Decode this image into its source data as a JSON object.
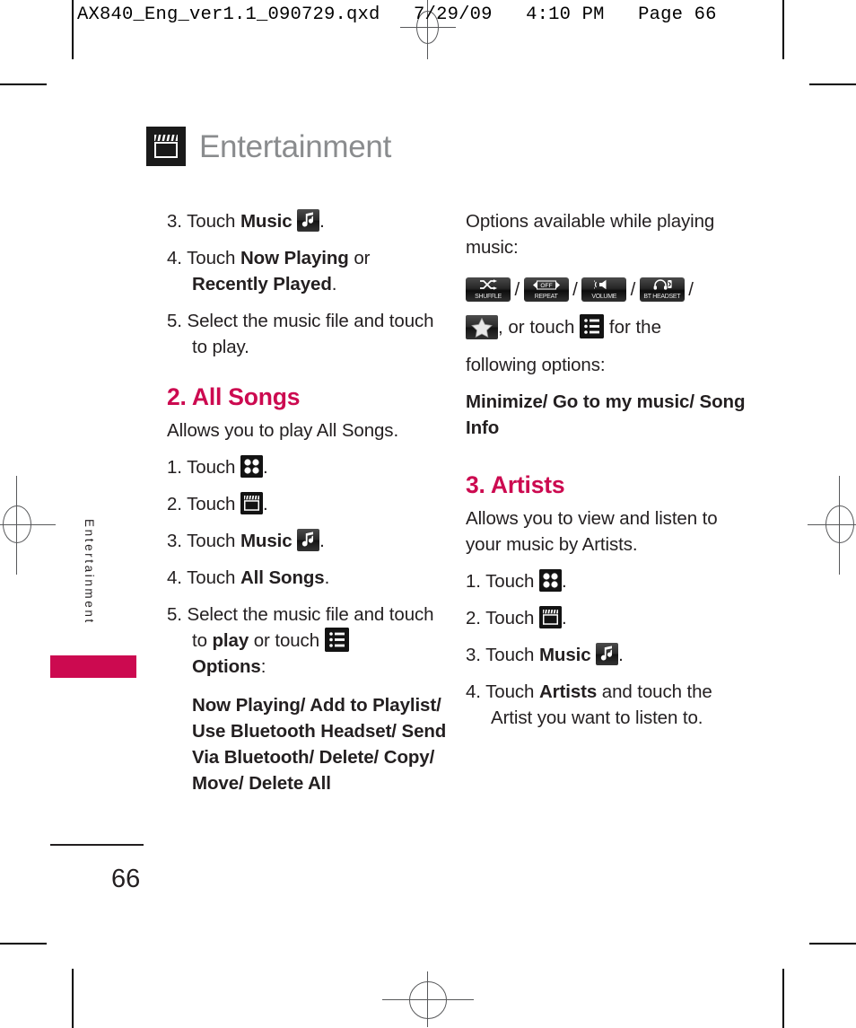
{
  "slug": {
    "text": "AX840_Eng_ver1.1_090729.qxd   7/29/09   4:10 PM   Page 66"
  },
  "page": {
    "title": "Entertainment",
    "title_icon": "clapperboard-icon",
    "side_tab_label": "Entertainment",
    "folio": "66",
    "accent_color": "#cc0a50",
    "title_color": "#8a8c8e"
  },
  "left_column": {
    "steps_continued": [
      {
        "num": "3.",
        "pre": "Touch ",
        "bold": "Music",
        "icon": "music-note-icon",
        "post": "."
      },
      {
        "num": "4.",
        "text_html": "Touch <b>Now Playing</b> or <b>Recently Played</b>."
      },
      {
        "num": "5.",
        "text_html": "Select the music file and touch to play."
      }
    ],
    "section": {
      "heading": "2. All Songs",
      "intro": "Allows you to play All Songs.",
      "steps": [
        {
          "num": "1.",
          "pre": "Touch ",
          "icon": "grid-four-dots-icon",
          "post": "."
        },
        {
          "num": "2.",
          "pre": "Touch ",
          "icon": "clapperboard-icon",
          "post": "."
        },
        {
          "num": "3.",
          "pre": "Touch ",
          "bold": "Music",
          "icon": "music-note-icon",
          "post": "."
        },
        {
          "num": "4.",
          "pre": "Touch ",
          "bold": "All Songs",
          "post": "."
        },
        {
          "num": "5.",
          "pre": "Select the music file and touch to ",
          "bold": "play",
          "mid": " or touch ",
          "icon": "list-menu-icon",
          "bold2": "Options",
          "post": ":"
        }
      ],
      "options_list": "Now Playing/ Add to Playlist/ Use Bluetooth Headset/ Send Via Bluetooth/ Delete/ Copy/ Move/ Delete All"
    }
  },
  "right_column": {
    "options_intro": "Options available while playing music:",
    "control_icons": [
      {
        "name": "shuffle-icon",
        "caption": "SHUFFLE"
      },
      {
        "name": "repeat-icon",
        "caption": "REPEAT",
        "badge": "OFF"
      },
      {
        "name": "volume-icon",
        "caption": "VOLUME"
      },
      {
        "name": "bt-headset-icon",
        "caption": "BT HEADSET"
      }
    ],
    "star_icon": "star-icon",
    "touch_text_pre": ", or touch ",
    "list_icon": "list-menu-icon",
    "touch_text_post": " for the",
    "following_options_label": "following options:",
    "following_options": "Minimize/ Go to my music/ Song Info",
    "section": {
      "heading": "3. Artists",
      "intro": "Allows you to view and listen to your music by Artists.",
      "steps": [
        {
          "num": "1.",
          "pre": "Touch ",
          "icon": "grid-four-dots-icon",
          "post": "."
        },
        {
          "num": "2.",
          "pre": "Touch ",
          "icon": "clapperboard-icon",
          "post": "."
        },
        {
          "num": "3.",
          "pre": "Touch ",
          "bold": "Music",
          "icon": "music-note-icon",
          "post": "."
        },
        {
          "num": "4.",
          "pre": "Touch ",
          "bold": "Artists",
          "post": " and touch the Artist you want to listen to."
        }
      ]
    }
  }
}
